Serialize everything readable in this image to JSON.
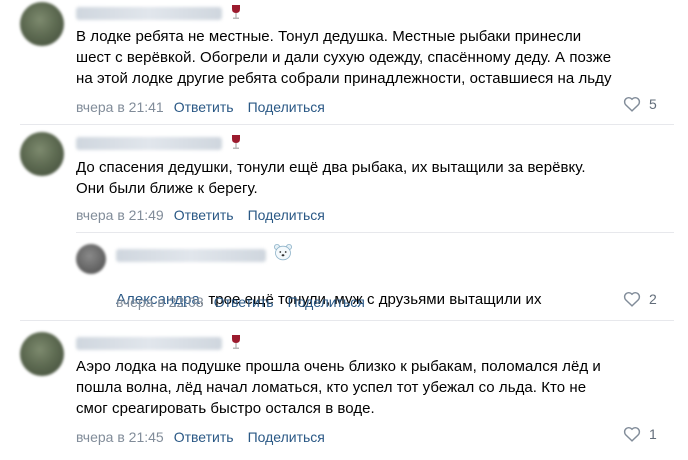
{
  "comments": [
    {
      "text": "В лодке ребята не местные. Тонул дедушка. Местные рыбаки принесли\nшест с верёвкой. Обогрели и дали сухую одежду, спасённому деду. А позже\nна этой лодке другие ребята собрали принадлежности, оставшиеся на льду",
      "time": "вчера в 21:41",
      "reply_label": "Ответить",
      "share_label": "Поделиться",
      "likes": "5",
      "author_icon": "wine-glass-icon"
    },
    {
      "text": "До спасения дедушки, тонули ещё два рыбака, их вытащили за верёвку.\nОни были ближе к берегу.",
      "time": "вчера в 21:49",
      "reply_label": "Ответить",
      "share_label": "Поделиться",
      "author_icon": "wine-glass-icon",
      "reply": {
        "mention": "Александра",
        "text": ", трое ещё тонули, муж с друзьями вытащили их",
        "time": "вчера в 22:08",
        "reply_label": "Ответить",
        "share_label": "Поделиться",
        "likes": "2",
        "author_icon": "polar-bear-icon"
      }
    },
    {
      "text": "Аэро лодка на подушке прошла очень близко к рыбакам, поломался лёд и\nпошла волна, лёд начал ломаться, кто успел тот убежал со льда. Кто не\nсмог среагировать быстро остался в воде.",
      "time": "вчера в 21:45",
      "reply_label": "Ответить",
      "share_label": "Поделиться",
      "likes": "1",
      "author_icon": "wine-glass-icon"
    }
  ],
  "colors": {
    "link": "#2a5885",
    "meta": "#818c99",
    "divider": "#e7e8ec"
  }
}
